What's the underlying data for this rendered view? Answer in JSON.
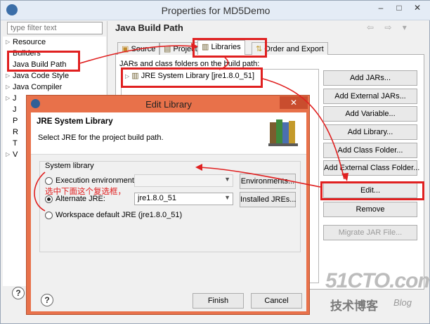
{
  "window": {
    "title": "Properties for MD5Demo",
    "controls": [
      "–",
      "□",
      "✕"
    ]
  },
  "filter": {
    "placeholder": "type filter text"
  },
  "tree": {
    "items": [
      {
        "label": "Resource",
        "arrow": true
      },
      {
        "label": "Builders",
        "arrow": false
      },
      {
        "label": "Java Build Path",
        "arrow": false
      },
      {
        "label": "Java Code Style",
        "arrow": true
      },
      {
        "label": "Java Compiler",
        "arrow": true
      },
      {
        "label": "J",
        "arrow": true
      },
      {
        "label": "J",
        "arrow": false
      },
      {
        "label": "P",
        "arrow": false
      },
      {
        "label": "R",
        "arrow": false
      },
      {
        "label": "T",
        "arrow": false
      },
      {
        "label": "V",
        "arrow": true
      }
    ]
  },
  "page": {
    "title": "Java Build Path",
    "nav": "⇦ ⇨ ▾",
    "tabs": [
      "Source",
      "Projects",
      "Libraries",
      "Order and Export"
    ],
    "jars_label": "JARs and class folders on the build path:",
    "jre_item": "JRE System Library [jre1.8.0_51]",
    "buttons": [
      "Add JARs...",
      "Add External JARs...",
      "Add Variable...",
      "Add Library...",
      "Add Class Folder...",
      "Add External Class Folder...",
      "Edit...",
      "Remove",
      "Migrate JAR File..."
    ]
  },
  "dialog": {
    "title": "Edit Library",
    "close": "✕",
    "header_title": "JRE System Library",
    "header_desc": "Select JRE for the project build path.",
    "group_label": "System library",
    "exec_env_label": "Execution environment:",
    "exec_env_value": "",
    "environments_button": "Environments...",
    "alternate_label": "Alternate JRE:",
    "alternate_value": "jre1.8.0_51",
    "installed_button": "Installed JREs...",
    "workspace_label": "Workspace default JRE (jre1.8.0_51)",
    "selected_option": "alternate",
    "annotation": "选中下面这个复选框，",
    "finish": "Finish",
    "cancel": "Cancel"
  },
  "help": {
    "symbol": "?"
  },
  "watermark": {
    "line1": "51CTO.com",
    "line2": "技术博客",
    "line3": "Blog"
  },
  "annotation_color": "#e02020"
}
